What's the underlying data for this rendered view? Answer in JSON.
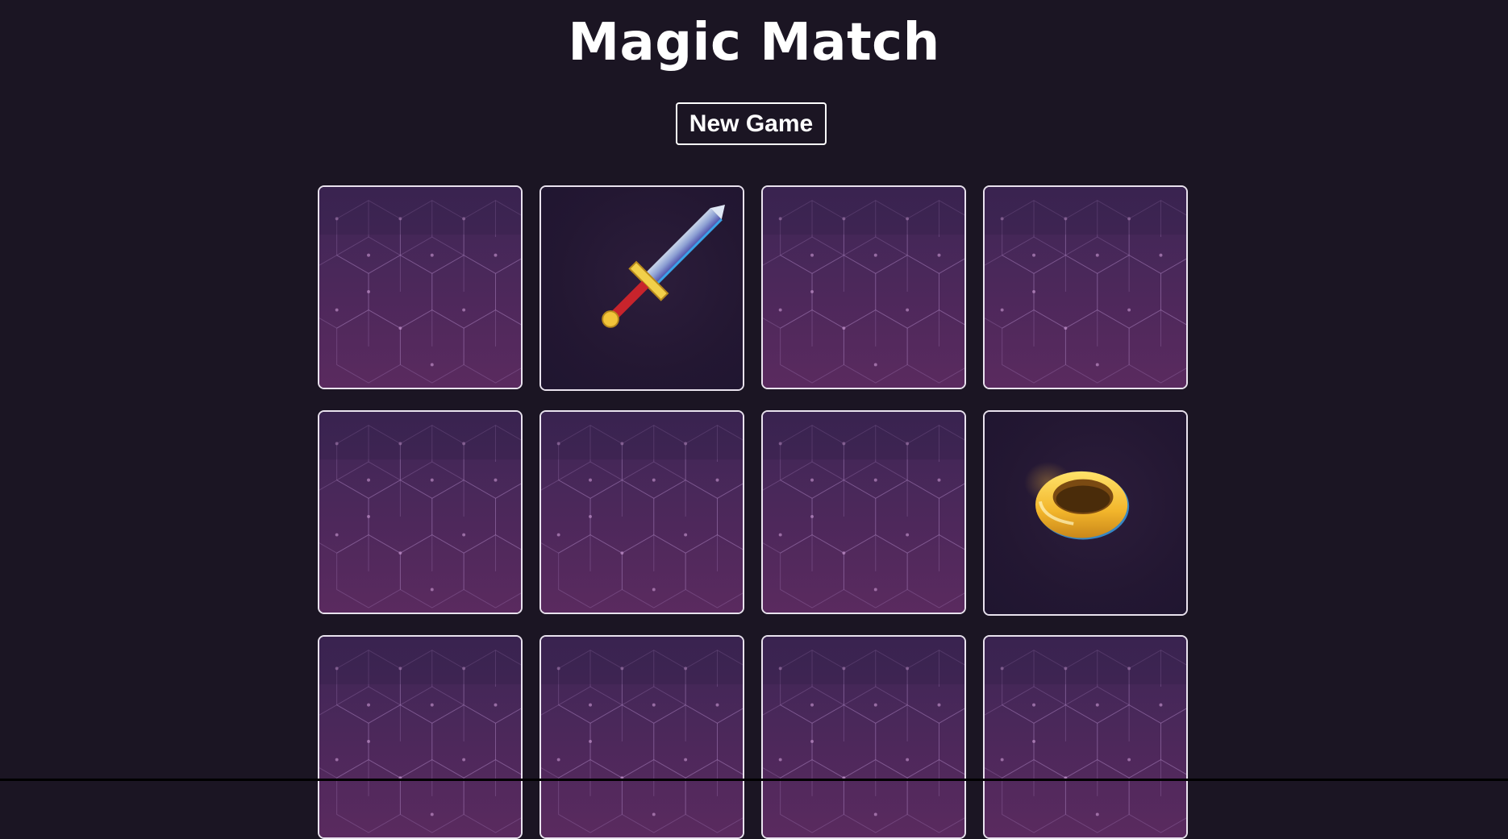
{
  "app": {
    "title": "Magic Match",
    "new_game_label": "New Game"
  },
  "board": {
    "columns": 4,
    "cards": [
      {
        "state": "face-down",
        "icon": "card-back-pattern"
      },
      {
        "state": "face-up",
        "icon": "sword-icon"
      },
      {
        "state": "face-down",
        "icon": "card-back-pattern"
      },
      {
        "state": "face-down",
        "icon": "card-back-pattern"
      },
      {
        "state": "face-down",
        "icon": "card-back-pattern"
      },
      {
        "state": "face-down",
        "icon": "card-back-pattern"
      },
      {
        "state": "face-down",
        "icon": "card-back-pattern"
      },
      {
        "state": "face-up",
        "icon": "ring-icon"
      },
      {
        "state": "face-down",
        "icon": "card-back-pattern"
      },
      {
        "state": "face-down",
        "icon": "card-back-pattern"
      },
      {
        "state": "face-down",
        "icon": "card-back-pattern"
      },
      {
        "state": "face-down",
        "icon": "card-back-pattern"
      }
    ]
  },
  "colors": {
    "background": "#1b1523",
    "card_back_top": "#3e2656",
    "card_back_bottom": "#5a2a5f",
    "card_border": "#e9e2ee"
  }
}
